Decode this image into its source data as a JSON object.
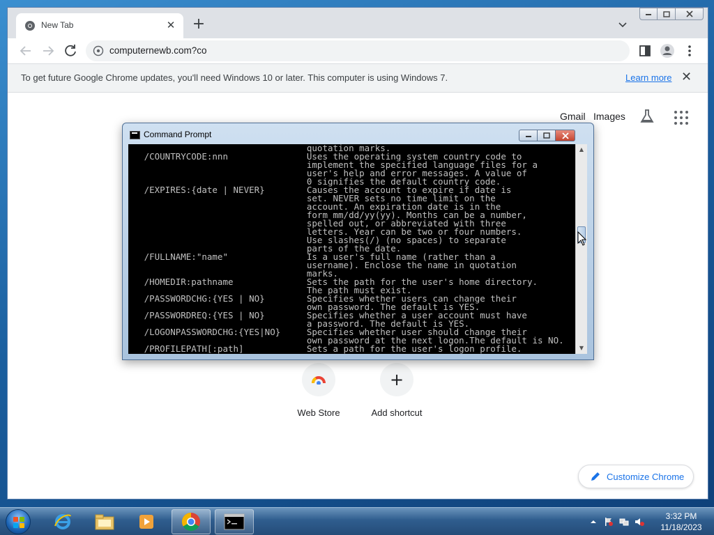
{
  "browser": {
    "tab_title": "New Tab",
    "url": "computernewb.com?co",
    "infobar_message": "To get future Google Chrome updates, you'll need Windows 10 or later. This computer is using Windows 7.",
    "infobar_link": "Learn more"
  },
  "ntp": {
    "gmail": "Gmail",
    "images": "Images",
    "shortcuts": [
      {
        "label": "Web Store",
        "icon": "webstore-icon"
      },
      {
        "label": "Add shortcut",
        "icon": "plus-icon"
      }
    ],
    "customize_label": "Customize Chrome"
  },
  "cmd": {
    "title": "Command Prompt",
    "lines": [
      "                                  quotation marks.",
      "   /COUNTRYCODE:nnn               Uses the operating system country code to",
      "                                  implement the specified language files for a",
      "                                  user's help and error messages. A value of",
      "                                  0 signifies the default country code.",
      "   /EXPIRES:{date | NEVER}        Causes the account to expire if date is",
      "                                  set. NEVER sets no time limit on the",
      "                                  account. An expiration date is in the",
      "                                  form mm/dd/yy(yy). Months can be a number,",
      "                                  spelled out, or abbreviated with three",
      "                                  letters. Year can be two or four numbers.",
      "                                  Use slashes(/) (no spaces) to separate",
      "                                  parts of the date.",
      "   /FULLNAME:\"name\"               Is a user's full name (rather than a",
      "                                  username). Enclose the name in quotation",
      "                                  marks.",
      "   /HOMEDIR:pathname              Sets the path for the user's home directory.",
      "                                  The path must exist.",
      "   /PASSWORDCHG:{YES | NO}        Specifies whether users can change their",
      "                                  own password. The default is YES.",
      "   /PASSWORDREQ:{YES | NO}        Specifies whether a user account must have",
      "                                  a password. The default is YES.",
      "   /LOGONPASSWORDCHG:{YES|NO}     Specifies whether user should change their",
      "                                  own password at the next logon.The default is NO.",
      "   /PROFILEPATH[:path]            Sets a path for the user's logon profile."
    ]
  },
  "taskbar": {
    "time": "3:32 PM",
    "date": "11/18/2023"
  },
  "colors": {
    "accent": "#1a73e8",
    "console_text": "#c0c0c0",
    "console_bg": "#000000"
  }
}
